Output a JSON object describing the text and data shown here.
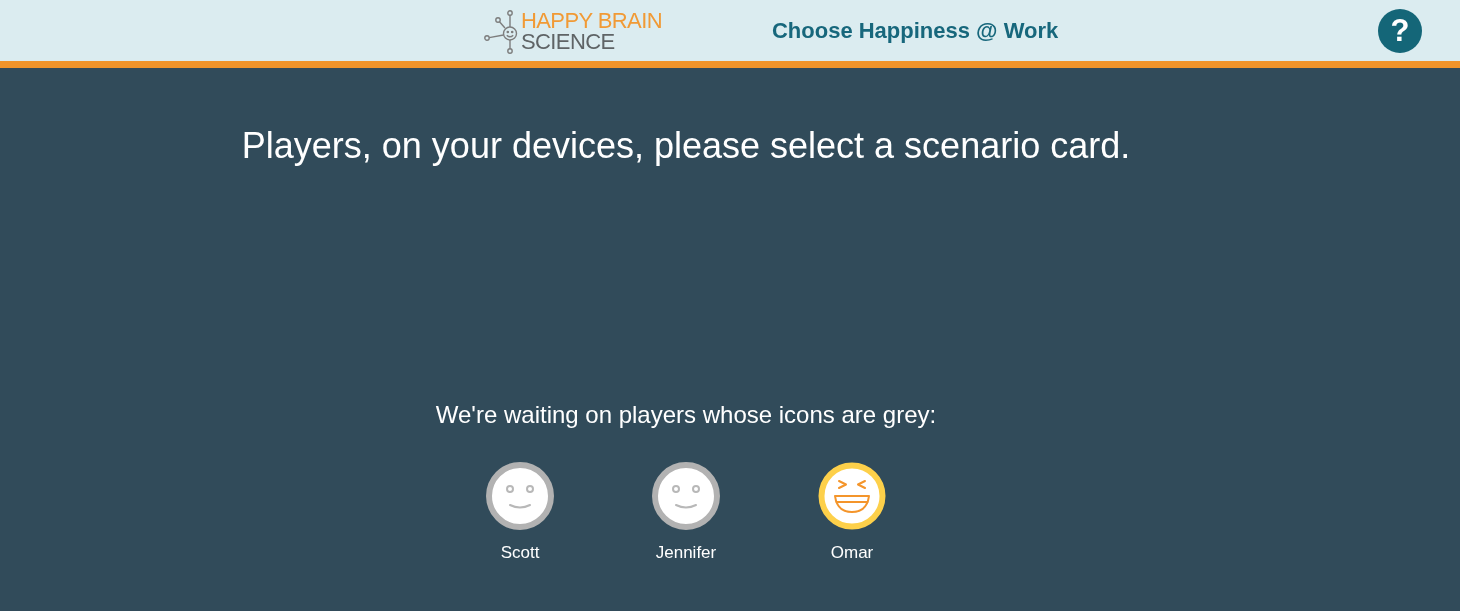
{
  "header": {
    "logo": {
      "line_1": "HAPPY BRAIN",
      "line_2": "SCIENCE"
    },
    "title": "Choose Happiness @ Work",
    "help_button": "?"
  },
  "main": {
    "prompt": "Players, on your devices, please select a scenario card.",
    "waiting_message": "We're waiting on players whose icons are grey:"
  },
  "players": [
    {
      "name": "Scott",
      "ready": false
    },
    {
      "name": "Jennifer",
      "ready": false
    },
    {
      "name": "Omar",
      "ready": true
    }
  ]
}
